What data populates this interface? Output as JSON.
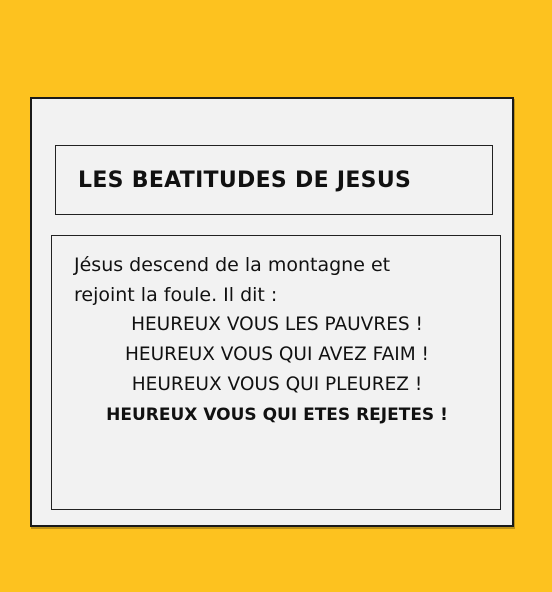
{
  "page": {
    "title": "LES BEATITUDES DE JESUS",
    "intro_line1": "Jésus descend de la montagne et",
    "intro_line2": "rejoint la foule. Il dit :",
    "beatitudes": [
      "HEUREUX VOUS LES PAUVRES !",
      "HEUREUX VOUS QUI AVEZ FAIM !",
      "HEUREUX VOUS QUI PLEUREZ !",
      "HEUREUX VOUS QUI ETES REJETES !"
    ]
  },
  "colors": {
    "background": "#fdc21f",
    "card": "#f2f2f2",
    "border": "#1a1a1a"
  }
}
